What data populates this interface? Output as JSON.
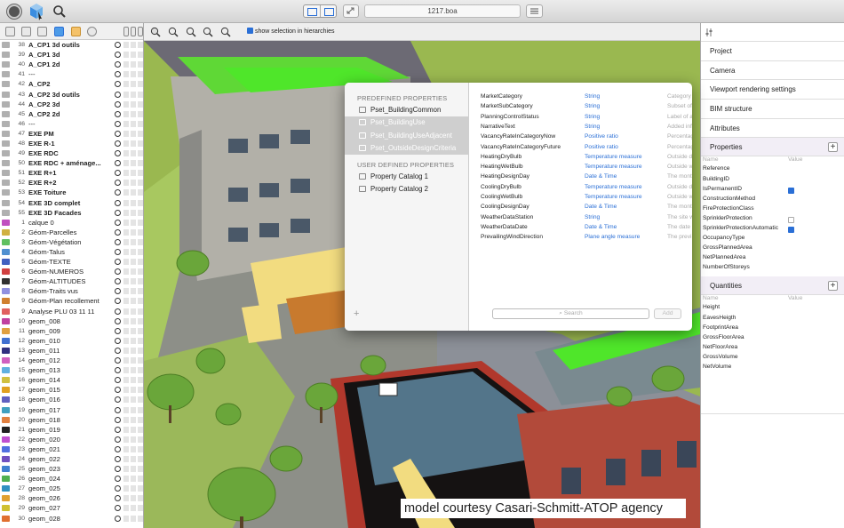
{
  "toolbar": {
    "title": "1217.boa",
    "left_icons": [
      "record-icon",
      "model-view-icon",
      "search-icon"
    ]
  },
  "layers": [
    {
      "num": "38",
      "name": "A_CP1 3d outils",
      "bold": true,
      "color": "#b0b0b0"
    },
    {
      "num": "39",
      "name": "A_CP1 3d",
      "bold": true,
      "color": "#b0b0b0"
    },
    {
      "num": "40",
      "name": "A_CP1 2d",
      "bold": true,
      "color": "#b0b0b0"
    },
    {
      "num": "41",
      "name": "---",
      "bold": false,
      "color": "#b0b0b0"
    },
    {
      "num": "42",
      "name": "A_CP2",
      "bold": true,
      "color": "#b0b0b0"
    },
    {
      "num": "43",
      "name": "A_CP2 3d outils",
      "bold": true,
      "color": "#b0b0b0"
    },
    {
      "num": "44",
      "name": "A_CP2 3d",
      "bold": true,
      "color": "#b0b0b0"
    },
    {
      "num": "45",
      "name": "A_CP2 2d",
      "bold": true,
      "color": "#b0b0b0"
    },
    {
      "num": "46",
      "name": "---",
      "bold": false,
      "color": "#b0b0b0"
    },
    {
      "num": "47",
      "name": "EXE PM",
      "bold": true,
      "color": "#b0b0b0"
    },
    {
      "num": "48",
      "name": "EXE R-1",
      "bold": true,
      "color": "#b0b0b0"
    },
    {
      "num": "49",
      "name": "EXE RDC",
      "bold": true,
      "color": "#b0b0b0"
    },
    {
      "num": "50",
      "name": "EXE RDC + aménage...",
      "bold": true,
      "color": "#b0b0b0"
    },
    {
      "num": "51",
      "name": "EXE R+1",
      "bold": true,
      "color": "#b0b0b0"
    },
    {
      "num": "52",
      "name": "EXE R+2",
      "bold": true,
      "color": "#b0b0b0"
    },
    {
      "num": "53",
      "name": "EXE Toiture",
      "bold": true,
      "color": "#b0b0b0"
    },
    {
      "num": "54",
      "name": "EXE 3D complet",
      "bold": true,
      "color": "#b0b0b0"
    },
    {
      "num": "55",
      "name": "EXE 3D Facades",
      "bold": true,
      "color": "#b0b0b0"
    },
    {
      "num": "1",
      "name": "calque 0",
      "bold": false,
      "color": "#c050c0"
    },
    {
      "num": "2",
      "name": "Géom-Parcelles",
      "bold": false,
      "color": "#d0b040"
    },
    {
      "num": "3",
      "name": "Géom-Végétation",
      "bold": false,
      "color": "#60c060"
    },
    {
      "num": "4",
      "name": "Géom-Talus",
      "bold": false,
      "color": "#5090d0"
    },
    {
      "num": "5",
      "name": "Géom-TEXTE",
      "bold": false,
      "color": "#4060c0"
    },
    {
      "num": "6",
      "name": "Géom-NUMEROS",
      "bold": false,
      "color": "#d04040"
    },
    {
      "num": "7",
      "name": "Géom-ALTITUDES",
      "bold": false,
      "color": "#303030"
    },
    {
      "num": "8",
      "name": "Géom-Traits vus",
      "bold": false,
      "color": "#9090e0"
    },
    {
      "num": "9",
      "name": "Géom-Plan recollement",
      "bold": false,
      "color": "#d08030"
    },
    {
      "num": "9",
      "name": "Analyse PLU 03 11 11",
      "bold": false,
      "color": "#e06060"
    },
    {
      "num": "10",
      "name": "geom_008",
      "bold": false,
      "color": "#c040a0"
    },
    {
      "num": "11",
      "name": "geom_009",
      "bold": false,
      "color": "#e0a040"
    },
    {
      "num": "12",
      "name": "geom_010",
      "bold": false,
      "color": "#4070d0"
    },
    {
      "num": "13",
      "name": "geom_011",
      "bold": false,
      "color": "#303080"
    },
    {
      "num": "14",
      "name": "geom_012",
      "bold": false,
      "color": "#d060c0"
    },
    {
      "num": "15",
      "name": "geom_013",
      "bold": false,
      "color": "#60b0e0"
    },
    {
      "num": "16",
      "name": "geom_014",
      "bold": false,
      "color": "#d0c040"
    },
    {
      "num": "17",
      "name": "geom_015",
      "bold": false,
      "color": "#e0a020"
    },
    {
      "num": "18",
      "name": "geom_016",
      "bold": false,
      "color": "#6060c0"
    },
    {
      "num": "19",
      "name": "geom_017",
      "bold": false,
      "color": "#40a0c0"
    },
    {
      "num": "20",
      "name": "geom_018",
      "bold": false,
      "color": "#e08040"
    },
    {
      "num": "21",
      "name": "geom_019",
      "bold": false,
      "color": "#202020"
    },
    {
      "num": "22",
      "name": "geom_020",
      "bold": false,
      "color": "#c050d0"
    },
    {
      "num": "23",
      "name": "geom_021",
      "bold": false,
      "color": "#5070e0"
    },
    {
      "num": "24",
      "name": "geom_022",
      "bold": false,
      "color": "#7050c0"
    },
    {
      "num": "25",
      "name": "geom_023",
      "bold": false,
      "color": "#4080d0"
    },
    {
      "num": "26",
      "name": "geom_024",
      "bold": false,
      "color": "#50b050"
    },
    {
      "num": "27",
      "name": "geom_025",
      "bold": false,
      "color": "#3090c0"
    },
    {
      "num": "28",
      "name": "geom_026",
      "bold": false,
      "color": "#e0a030"
    },
    {
      "num": "29",
      "name": "geom_027",
      "bold": false,
      "color": "#d0c030"
    },
    {
      "num": "30",
      "name": "geom_028",
      "bold": false,
      "color": "#e07030"
    }
  ],
  "viewport_toolbar": {
    "show_selection_label": "show selection in hierarchies",
    "show_selection_checked": true
  },
  "popup": {
    "predefined_header": "PREDEFINED PROPERTIES",
    "predefined": [
      {
        "label": "Pset_BuildingCommon",
        "selected": false
      },
      {
        "label": "Pset_BuildingUse",
        "selected": true
      },
      {
        "label": "Pset_BuildingUseAdjacent",
        "selected": true
      },
      {
        "label": "Pset_OutsideDesignCriteria",
        "selected": true
      }
    ],
    "user_header": "USER DEFINED PROPERTIES",
    "user_defined": [
      "Property Catalog 1",
      "Property Catalog 2"
    ],
    "add_symbol": "+",
    "properties": [
      {
        "name": "MarketCategory",
        "type": "String",
        "desc": "Category"
      },
      {
        "name": "MarketSubCategory",
        "type": "String",
        "desc": "Subset of"
      },
      {
        "name": "PlanningControlStatus",
        "type": "String",
        "desc": "Label of a"
      },
      {
        "name": "NarrativeText",
        "type": "String",
        "desc": "Added infi"
      },
      {
        "name": "VacancyRateInCategoryNow",
        "type": "Positive ratio",
        "desc": "Percentag"
      },
      {
        "name": "VacancyRateInCategoryFuture",
        "type": "Positive ratio",
        "desc": "Percentag"
      },
      {
        "name": "HeatingDryBulb",
        "type": "Temperature measure",
        "desc": "Outside d"
      },
      {
        "name": "HeatingWetBulb",
        "type": "Temperature measure",
        "desc": "Outside w"
      },
      {
        "name": "HeatingDesignDay",
        "type": "Date & Time",
        "desc": "The month"
      },
      {
        "name": "CoolingDryBulb",
        "type": "Temperature measure",
        "desc": "Outside d"
      },
      {
        "name": "CoolingWetBulb",
        "type": "Temperature measure",
        "desc": "Outside w"
      },
      {
        "name": "CoolingDesignDay",
        "type": "Date & Time",
        "desc": "The montl"
      },
      {
        "name": "WeatherDataStation",
        "type": "String",
        "desc": "The site w"
      },
      {
        "name": "WeatherDataDate",
        "type": "Date & Time",
        "desc": "The date f"
      },
      {
        "name": "PrevailingWindDirection",
        "type": "Plane angle measure",
        "desc": "The previ"
      }
    ],
    "search_placeholder": "Search",
    "add_label": "Add"
  },
  "credit": "model courtesy Casari-Schmitt-ATOP agency",
  "right_panel": {
    "sections": [
      "Project",
      "Camera",
      "Viewport rendering settings",
      "BIM structure",
      "Attributes"
    ],
    "properties_header": "Properties",
    "col_name": "Name",
    "col_value": "Value",
    "properties": [
      {
        "name": "Reference",
        "check": null
      },
      {
        "name": "BuildingID",
        "check": null
      },
      {
        "name": "IsPermanentID",
        "check": "checked"
      },
      {
        "name": "ConstructionMethod",
        "check": null
      },
      {
        "name": "FireProtectionClass",
        "check": null
      },
      {
        "name": "SprinklerProtection",
        "check": "unchecked"
      },
      {
        "name": "SprinklerProtectionAutomatic",
        "check": "checked"
      },
      {
        "name": "OccupancyType",
        "check": null
      },
      {
        "name": "GrossPlannedArea",
        "check": null
      },
      {
        "name": "NetPlannedArea",
        "check": null
      },
      {
        "name": "NumberOfStoreys",
        "check": null
      }
    ],
    "quantities_header": "Quantities",
    "quantities": [
      "Height",
      "EavesHeigth",
      "FootprintArea",
      "GrossFloorArea",
      "NetFloorArea",
      "GrossVolume",
      "NetVolume"
    ]
  },
  "colors": {
    "accent": "#2a6fd6",
    "roof_green": "#4fe62a",
    "ground_grass": "#a8c860"
  }
}
